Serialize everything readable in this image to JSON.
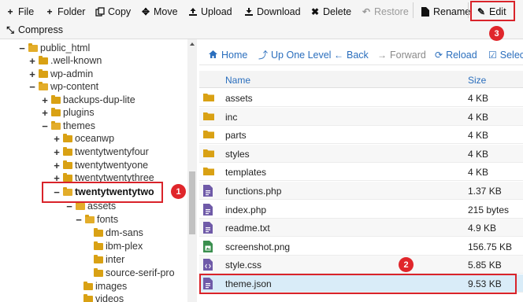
{
  "toolbar": {
    "file": "File",
    "folder": "Folder",
    "copy": "Copy",
    "move": "Move",
    "upload": "Upload",
    "download": "Download",
    "delete": "Delete",
    "restore": "Restore",
    "rename": "Rename",
    "edit": "Edit",
    "compress": "Compress"
  },
  "badges": {
    "one": "1",
    "two": "2",
    "three": "3"
  },
  "tree": {
    "items": [
      {
        "toggle": "−",
        "label": "public_html"
      },
      {
        "toggle": "+",
        "label": ".well-known"
      },
      {
        "toggle": "+",
        "label": "wp-admin"
      },
      {
        "toggle": "−",
        "label": "wp-content"
      },
      {
        "toggle": "+",
        "label": "backups-dup-lite"
      },
      {
        "toggle": "+",
        "label": "plugins"
      },
      {
        "toggle": "−",
        "label": "themes"
      },
      {
        "toggle": "+",
        "label": "oceanwp"
      },
      {
        "toggle": "+",
        "label": "twentytwentyfour"
      },
      {
        "toggle": "+",
        "label": "twentytwentyone"
      },
      {
        "toggle": "+",
        "label": "twentytwentythree"
      },
      {
        "toggle": "−",
        "label": "twentytwentytwo"
      },
      {
        "toggle": "−",
        "label": "assets"
      },
      {
        "toggle": "−",
        "label": "fonts"
      },
      {
        "toggle": "",
        "label": "dm-sans"
      },
      {
        "toggle": "",
        "label": "ibm-plex"
      },
      {
        "toggle": "",
        "label": "inter"
      },
      {
        "toggle": "",
        "label": "source-serif-pro"
      },
      {
        "toggle": "",
        "label": "images"
      },
      {
        "toggle": "",
        "label": "videos"
      }
    ]
  },
  "nav": {
    "home": "Home",
    "up": "Up One Level",
    "back": "Back",
    "forward": "Forward",
    "reload": "Reload",
    "select": "Selec"
  },
  "table": {
    "headers": {
      "name": "Name",
      "size": "Size"
    },
    "rows": [
      {
        "name": "assets",
        "size": "4 KB",
        "icon": "folder-icon"
      },
      {
        "name": "inc",
        "size": "4 KB",
        "icon": "folder-icon"
      },
      {
        "name": "parts",
        "size": "4 KB",
        "icon": "folder-icon"
      },
      {
        "name": "styles",
        "size": "4 KB",
        "icon": "folder-icon"
      },
      {
        "name": "templates",
        "size": "4 KB",
        "icon": "folder-icon"
      },
      {
        "name": "functions.php",
        "size": "1.37 KB",
        "icon": "text-file-icon"
      },
      {
        "name": "index.php",
        "size": "215 bytes",
        "icon": "text-file-icon"
      },
      {
        "name": "readme.txt",
        "size": "4.9 KB",
        "icon": "text-file-icon"
      },
      {
        "name": "screenshot.png",
        "size": "156.75 KB",
        "icon": "image-file-icon"
      },
      {
        "name": "style.css",
        "size": "5.85 KB",
        "icon": "code-file-icon"
      },
      {
        "name": "theme.json",
        "size": "9.53 KB",
        "icon": "text-file-icon"
      }
    ]
  },
  "colors": {
    "accent": "#2a6ebd",
    "highlight": "#d9232a",
    "folder": "#d9a114",
    "file": "#6f5aa8",
    "image": "#3a8f4e"
  }
}
